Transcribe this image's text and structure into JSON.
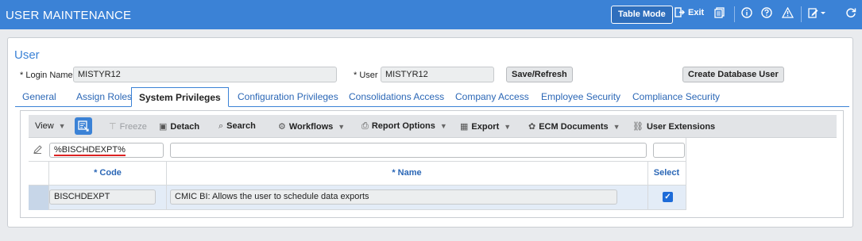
{
  "header": {
    "title": "USER MAINTENANCE",
    "table_mode_label": "Table Mode",
    "exit_label": "Exit",
    "icons": [
      "exit-icon",
      "print-icon",
      "info-icon",
      "help-icon",
      "warning-icon",
      "edit-icon",
      "refresh-icon"
    ]
  },
  "user_section": {
    "title": "User",
    "login_name_label": "Login Name",
    "login_name_value": "MISTYR12",
    "user_label": "User",
    "user_value": "MISTYR12",
    "required_marker": "*",
    "save_refresh_label": "Save/Refresh",
    "create_db_user_label": "Create Database User"
  },
  "tabs": [
    {
      "label": "General"
    },
    {
      "label": "Assign Roles"
    },
    {
      "label": "System Privileges"
    },
    {
      "label": "Configuration Privileges"
    },
    {
      "label": "Consolidations Access"
    },
    {
      "label": "Company Access"
    },
    {
      "label": "Employee Security"
    },
    {
      "label": "Compliance Security"
    }
  ],
  "toolbar": {
    "view_label": "View",
    "freeze_label": "Freeze",
    "detach_label": "Detach",
    "search_label": "Search",
    "workflows_label": "Workflows",
    "report_options_label": "Report Options",
    "export_label": "Export",
    "ecm_documents_label": "ECM Documents",
    "user_extensions_label": "User Extensions"
  },
  "grid": {
    "filter_code_value": "%BISCHDEXPT%",
    "filter_name_value": "",
    "columns": {
      "code": "* Code",
      "name": "* Name",
      "select": "Select"
    },
    "rows": [
      {
        "code": "BISCHDEXPT",
        "name": "CMIC BI: Allows the user to schedule data exports",
        "selected": true
      }
    ]
  },
  "colors": {
    "header_bg": "#3b82d6",
    "accent": "#3b82d6",
    "link": "#2b67b6",
    "selected_row": "#e3ecf7"
  }
}
